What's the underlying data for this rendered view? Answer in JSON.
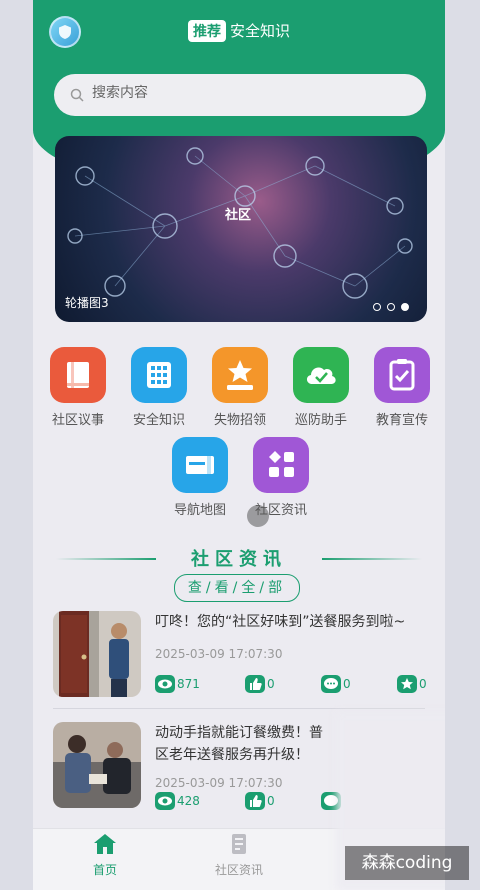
{
  "header": {
    "tag": "推荐",
    "title": "安全知识"
  },
  "search": {
    "placeholder": "搜索内容"
  },
  "banner": {
    "center_label": "社区",
    "caption": "轮播图3",
    "dots": 3,
    "active_dot": 3
  },
  "grid": [
    {
      "label": "社区议事",
      "icon": "book-icon",
      "color": "#ea5a3c"
    },
    {
      "label": "安全知识",
      "icon": "calculator-icon",
      "color": "#27a5e8"
    },
    {
      "label": "失物招领",
      "icon": "star-box-icon",
      "color": "#f4962a"
    },
    {
      "label": "巡防助手",
      "icon": "cloud-check-icon",
      "color": "#2fb453"
    },
    {
      "label": "教育宣传",
      "icon": "clipboard-check-icon",
      "color": "#a057d6"
    },
    {
      "label": "导航地图",
      "icon": "map-card-icon",
      "color": "#27a5e8"
    },
    {
      "label": "社区资讯",
      "icon": "grid-apps-icon",
      "color": "#a057d6"
    }
  ],
  "section": {
    "title": "社区资讯",
    "view_all": "查/看/全/部"
  },
  "news": [
    {
      "headline": "叮咚！您的“社区好味到”送餐服务到啦~",
      "time": "2025-03-09 17:07:30",
      "views": "871",
      "likes": "0",
      "comments": "0",
      "favorites": "0"
    },
    {
      "headline": "动动手指就能订餐缴费！普\n区老年送餐服务再升级！",
      "time": "2025-03-09 17:07:30",
      "views": "428",
      "likes": "0"
    }
  ],
  "tabbar": [
    {
      "label": "首页",
      "active": true
    },
    {
      "label": "社区资讯",
      "active": false
    }
  ],
  "watermark": "森森coding",
  "colors": {
    "primary": "#1b9e70",
    "background": "#ecebf1"
  }
}
